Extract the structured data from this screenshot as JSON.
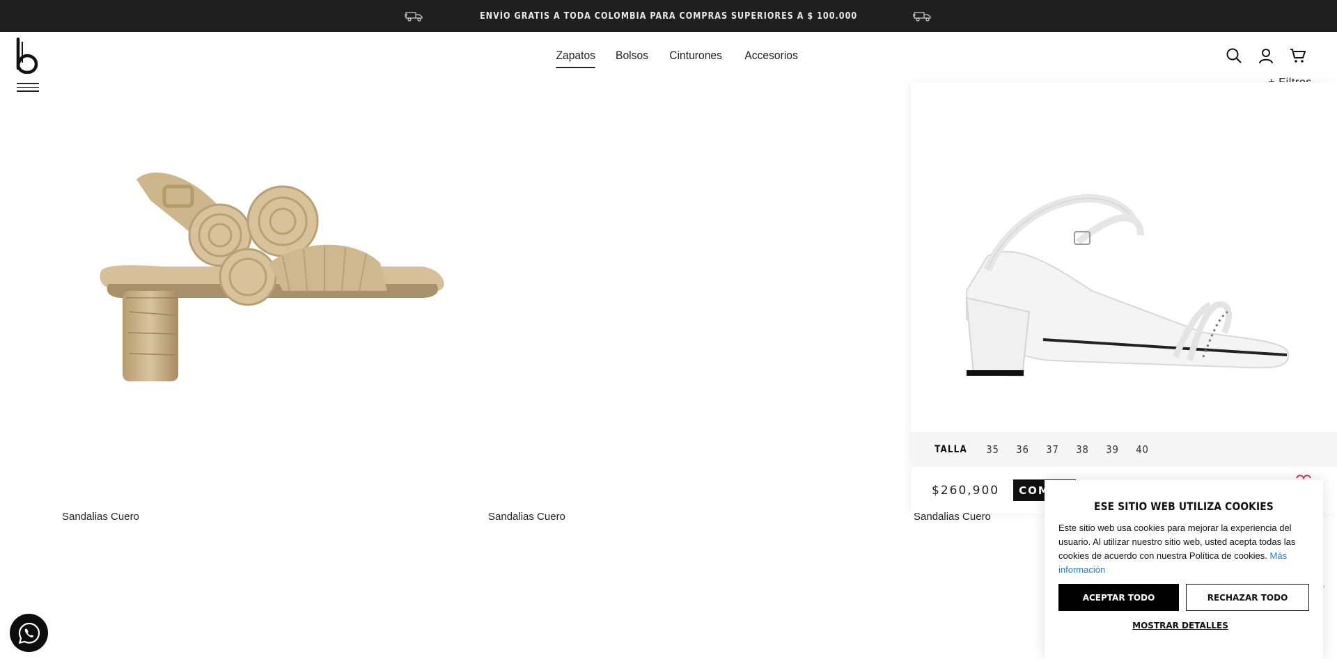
{
  "promo": {
    "text": "ENVÍO GRATIS A TODA COLOMBIA PARA COMPRAS SUPERIORES A $ 100.000",
    "icon": "truck-icon"
  },
  "header": {
    "logo": "brand-logo",
    "nav": [
      {
        "label": "Zapatos",
        "active": true
      },
      {
        "label": "Bolsos"
      },
      {
        "label": "Cinturones"
      },
      {
        "label": "Accesorios"
      }
    ],
    "icons": [
      "search-icon",
      "user-icon",
      "cart-icon"
    ],
    "filters_label": "+ Filtros"
  },
  "products": [
    {
      "name": "Sandalias Cuero",
      "color": "#d9c4a0"
    },
    {
      "name": "Sandalias Cuero"
    },
    {
      "name": "Sandalias Cuero",
      "color": "#ffffff",
      "size_label": "TALLA",
      "sizes": [
        "35",
        "36",
        "37",
        "38",
        "39",
        "40"
      ],
      "price": "$260,900",
      "buy_label": "COMPRAR"
    }
  ],
  "cookie": {
    "title": "ESE SITIO WEB UTILIZA COOKIES",
    "text": "Este sitio web usa cookies para mejorar la experiencia del usuario. Al utilizar nuestro sitio web, usted acepta todas las cookies de acuerdo con nuestra Política de cookies.",
    "link": "Más información",
    "accept": "ACEPTAR TODO",
    "reject": "RECHAZAR TODO",
    "details": "MOSTRAR DETALLES"
  },
  "colors": {
    "promo_bg": "#1f1f1f",
    "link": "#2a7bd8",
    "heart": "#e0344f"
  }
}
